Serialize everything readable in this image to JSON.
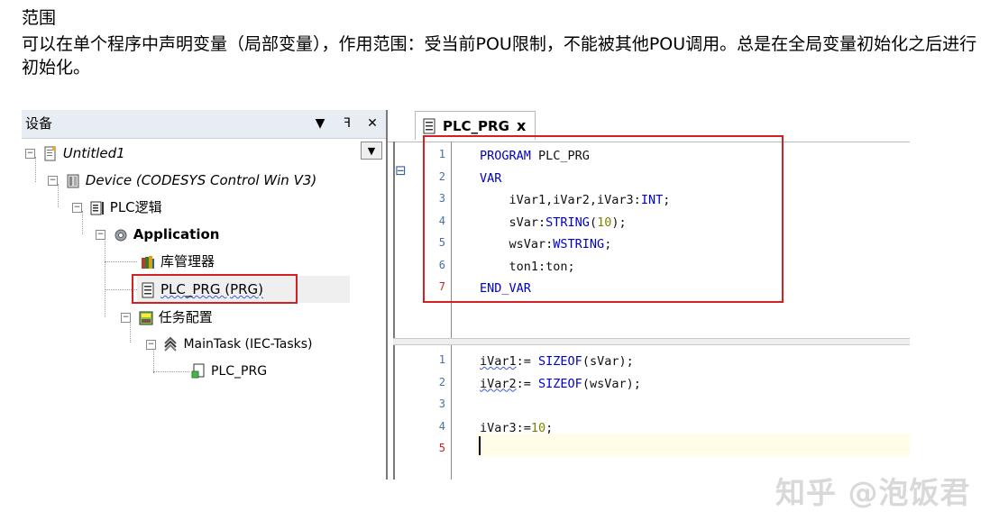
{
  "doc": {
    "title": "范围",
    "body": "可以在单个程序中声明变量（局部变量），作用范围：受当前POU限制，不能被其他POU调用。总是在全局变量初始化之后进行初始化。"
  },
  "device_panel": {
    "title": "设备",
    "header_buttons": {
      "dropdown": "▼",
      "pin": "ꟻ",
      "close": "✕"
    },
    "tree": {
      "untitled": "Untitled1",
      "device": "Device (CODESYS Control Win V3)",
      "plc_logic": "PLC逻辑",
      "application": "Application",
      "library_manager": "库管理器",
      "plc_prg": "PLC_PRG (PRG)",
      "task_config": "任务配置",
      "main_task": "MainTask (IEC-Tasks)",
      "task_plc_prg": "PLC_PRG"
    }
  },
  "editor": {
    "tab_label": "PLC_PRG",
    "tab_close": "x",
    "fold_marker": "⊟",
    "decl_lines": [
      {
        "n": "1",
        "tokens": [
          {
            "t": "PROGRAM ",
            "c": "kw"
          },
          {
            "t": "PLC_PRG",
            "c": "id"
          }
        ]
      },
      {
        "n": "2",
        "tokens": [
          {
            "t": "VAR",
            "c": "kw"
          }
        ]
      },
      {
        "n": "3",
        "tokens": [
          {
            "t": "    iVar1,iVar2,iVar3:",
            "c": "id"
          },
          {
            "t": "INT",
            "c": "kw"
          },
          {
            "t": ";",
            "c": "id"
          }
        ]
      },
      {
        "n": "4",
        "tokens": [
          {
            "t": "    sVar:",
            "c": "id"
          },
          {
            "t": "STRING",
            "c": "kw"
          },
          {
            "t": "(",
            "c": "id"
          },
          {
            "t": "10",
            "c": "num"
          },
          {
            "t": ");",
            "c": "id"
          }
        ]
      },
      {
        "n": "5",
        "tokens": [
          {
            "t": "    wsVar:",
            "c": "id"
          },
          {
            "t": "WSTRING",
            "c": "kw"
          },
          {
            "t": ";",
            "c": "id"
          }
        ]
      },
      {
        "n": "6",
        "tokens": [
          {
            "t": "    ton1:ton;",
            "c": "id"
          }
        ]
      },
      {
        "n": "7",
        "tokens": [
          {
            "t": "END_VAR",
            "c": "kw"
          }
        ]
      }
    ],
    "impl_lines": [
      {
        "n": "1",
        "tokens": [
          {
            "t": "iVar1",
            "c": "id",
            "sq": true
          },
          {
            "t": ":= ",
            "c": "id"
          },
          {
            "t": "SIZEOF",
            "c": "kw"
          },
          {
            "t": "(sVar);",
            "c": "id"
          }
        ]
      },
      {
        "n": "2",
        "tokens": [
          {
            "t": "iVar2",
            "c": "id",
            "sq": true
          },
          {
            "t": ":= ",
            "c": "id"
          },
          {
            "t": "SIZEOF",
            "c": "kw"
          },
          {
            "t": "(wsVar);",
            "c": "id"
          }
        ]
      },
      {
        "n": "3",
        "tokens": []
      },
      {
        "n": "4",
        "tokens": [
          {
            "t": "iVar3:=",
            "c": "id"
          },
          {
            "t": "10",
            "c": "num"
          },
          {
            "t": ";",
            "c": "id"
          }
        ]
      },
      {
        "n": "5",
        "tokens": []
      }
    ]
  },
  "watermark": "知乎 @泡饭君",
  "colors": {
    "highlight_box": "#d42020",
    "keyword": "#0000c8",
    "number": "#808000"
  }
}
